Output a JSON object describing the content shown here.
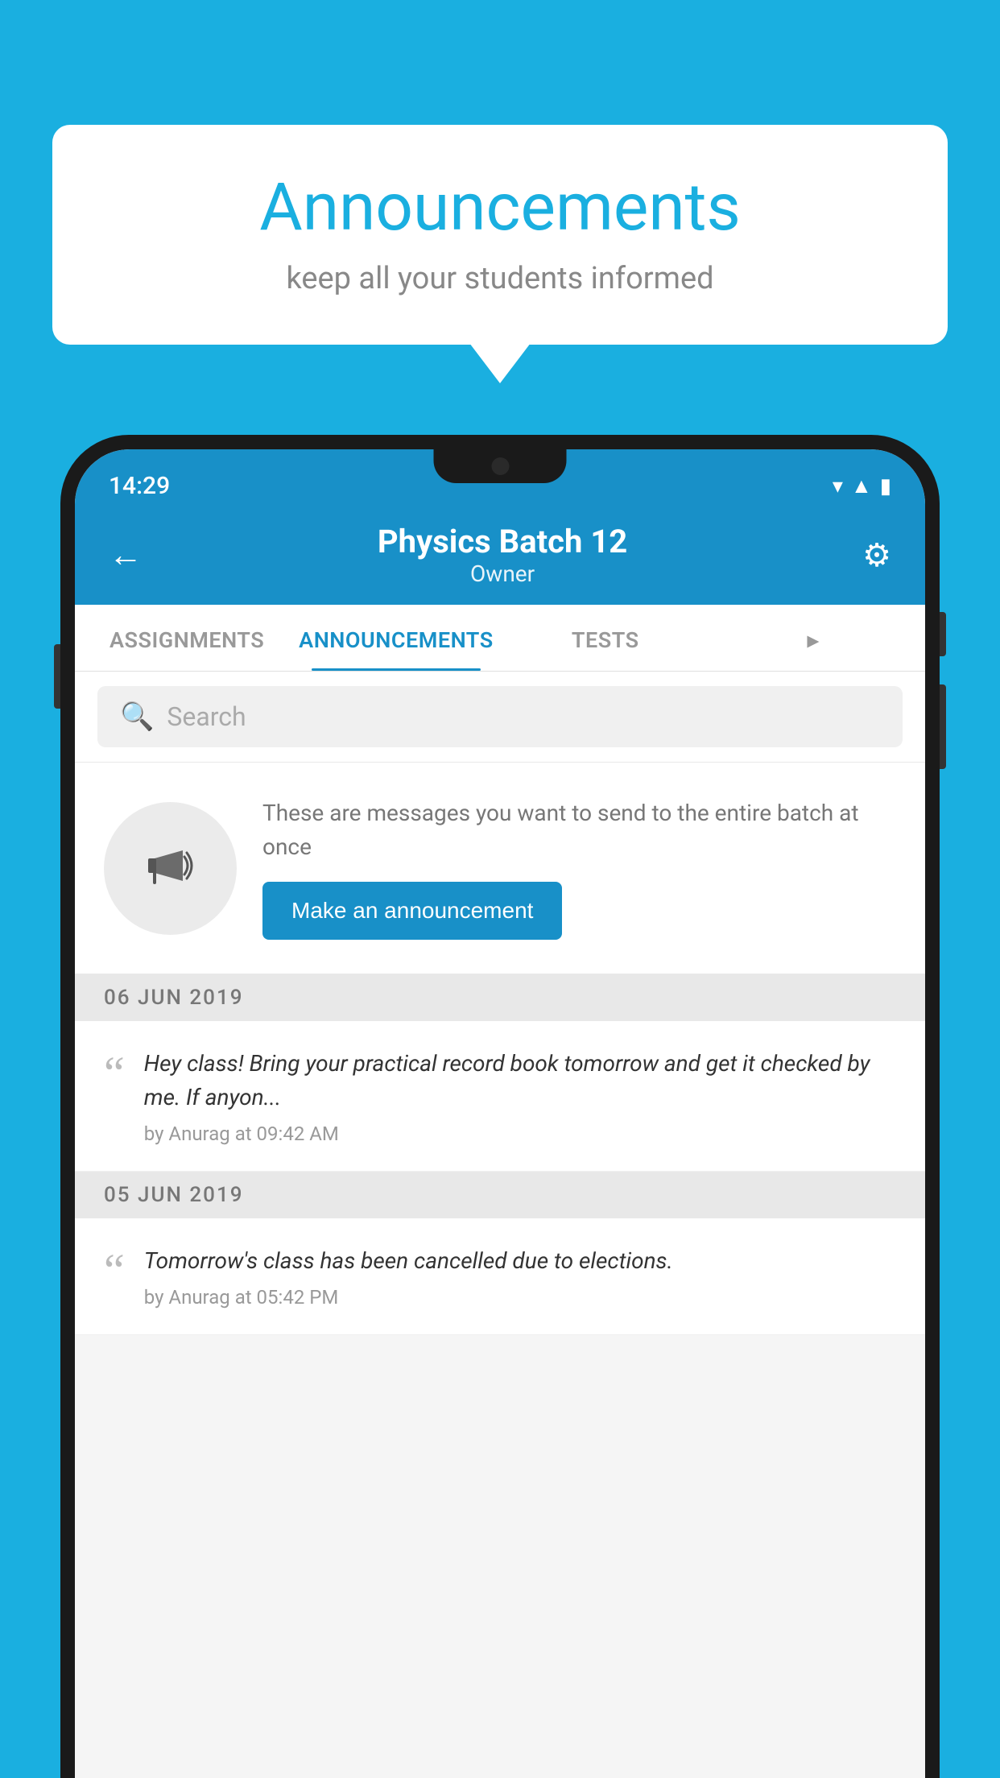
{
  "page": {
    "background_color": "#1AAFE0"
  },
  "speech_bubble": {
    "title": "Announcements",
    "subtitle": "keep all your students informed"
  },
  "status_bar": {
    "time": "14:29",
    "icons": [
      "wifi",
      "signal",
      "battery"
    ]
  },
  "app_bar": {
    "back_label": "←",
    "title": "Physics Batch 12",
    "subtitle": "Owner",
    "settings_label": "⚙"
  },
  "tabs": [
    {
      "label": "ASSIGNMENTS",
      "active": false
    },
    {
      "label": "ANNOUNCEMENTS",
      "active": true
    },
    {
      "label": "TESTS",
      "active": false
    },
    {
      "label": "...",
      "active": false
    }
  ],
  "search": {
    "placeholder": "Search"
  },
  "prompt_card": {
    "icon_label": "📢",
    "description": "These are messages you want to send to the entire batch at once",
    "button_label": "Make an announcement"
  },
  "announcements": [
    {
      "date": "06  JUN  2019",
      "message": "Hey class! Bring your practical record book tomorrow and get it checked by me. If anyon...",
      "meta": "by Anurag at 09:42 AM"
    },
    {
      "date": "05  JUN  2019",
      "message": "Tomorrow's class has been cancelled due to elections.",
      "meta": "by Anurag at 05:42 PM"
    }
  ]
}
